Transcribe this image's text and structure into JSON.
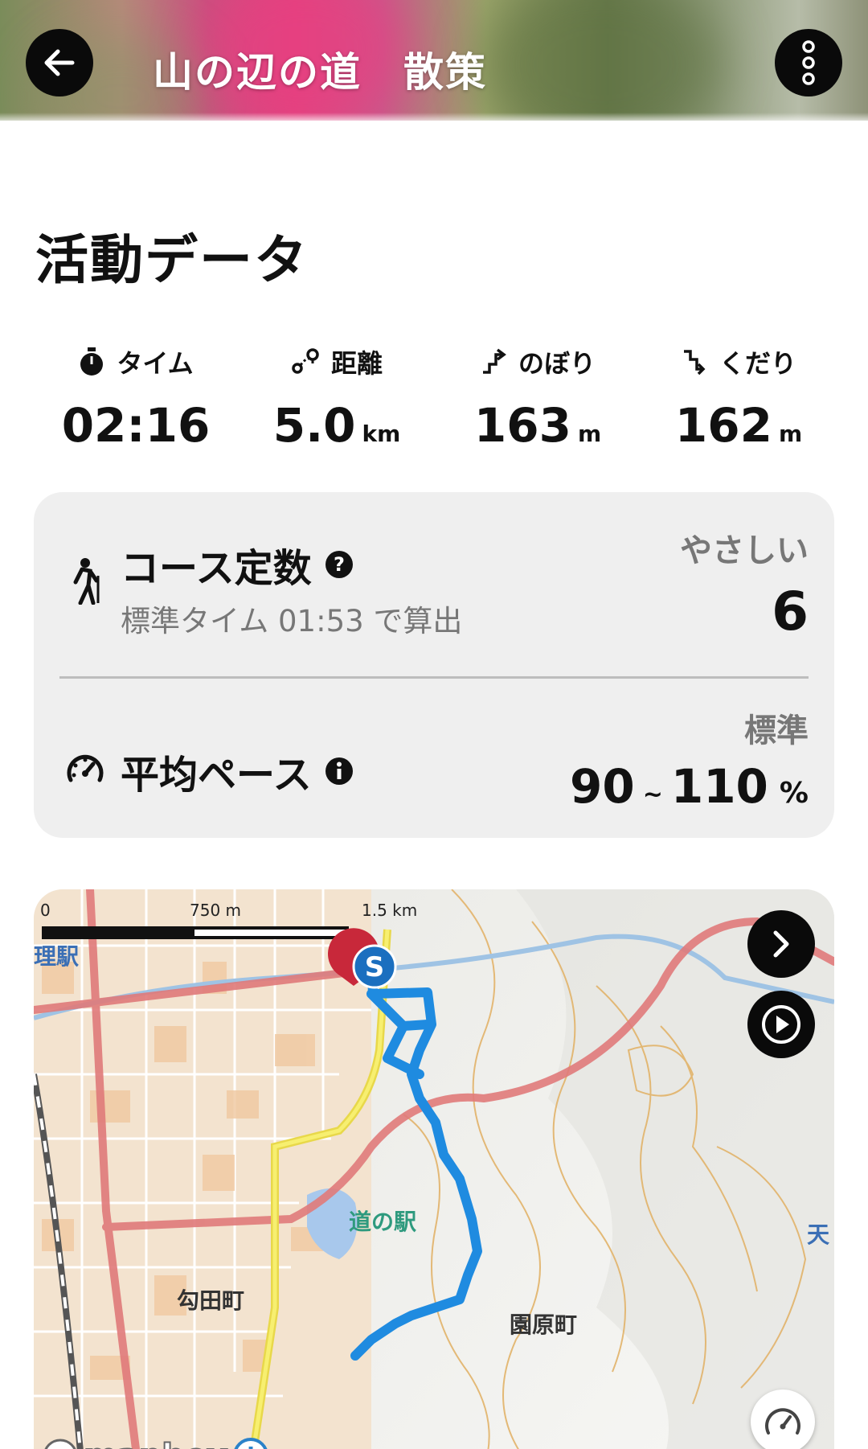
{
  "header": {
    "title": "山の辺の道　散策"
  },
  "section": {
    "title": "活動データ"
  },
  "stats": [
    {
      "icon": "stopwatch-icon",
      "label": "タイム",
      "value": "02:16",
      "unit": ""
    },
    {
      "icon": "route-icon",
      "label": "距離",
      "value": "5.0",
      "unit": "km"
    },
    {
      "icon": "ascent-icon",
      "label": "のぼり",
      "value": "163",
      "unit": "m"
    },
    {
      "icon": "descent-icon",
      "label": "くだり",
      "value": "162",
      "unit": "m"
    }
  ],
  "course": {
    "title": "コース定数",
    "subtitle": "標準タイム 01:53 で算出",
    "rating_label": "やさしい",
    "value": "6"
  },
  "pace": {
    "title": "平均ペース",
    "label": "標準",
    "min": "90",
    "tilde": "~",
    "max": "110",
    "unit": "%"
  },
  "map": {
    "scale_labels": [
      "0",
      "750 m",
      "1.5 km"
    ],
    "start_marker": "S",
    "places": {
      "station_partial": "理駅",
      "michinoeki": "道の駅",
      "magarita": "勾田町",
      "sonohara": "園原町",
      "ten_partial": "天"
    },
    "attribution": "mapbox",
    "info": "i"
  },
  "colors": {
    "route": "#1f8be0",
    "road_red": "#e07a7a",
    "road_yellow": "#f0e040",
    "contour": "#e2b36a",
    "card_bg": "#efefef"
  }
}
